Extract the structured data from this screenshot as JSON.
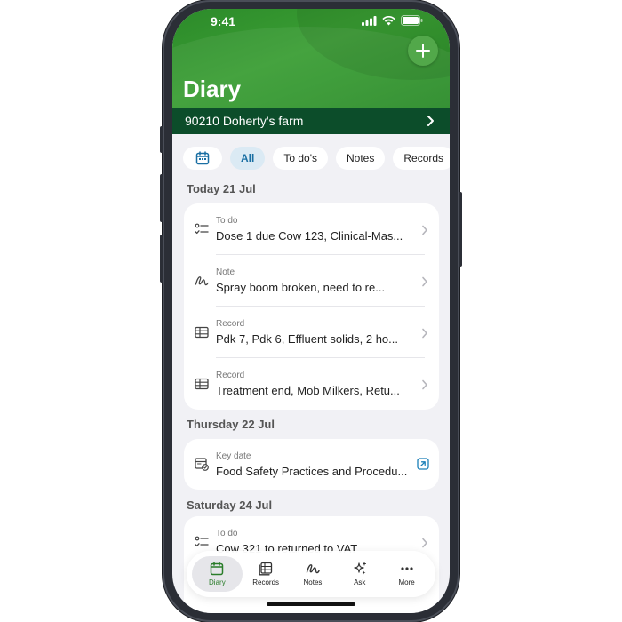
{
  "status_bar": {
    "time": "9:41"
  },
  "header": {
    "title": "Diary"
  },
  "farm": {
    "name": "90210 Doherty's farm"
  },
  "filters": [
    {
      "label": "All",
      "active": true
    },
    {
      "label": "To do's",
      "active": false
    },
    {
      "label": "Notes",
      "active": false
    },
    {
      "label": "Records",
      "active": false
    }
  ],
  "sections": [
    {
      "heading": "Today 21 Jul",
      "items": [
        {
          "type": "To do",
          "title": "Dose 1 due Cow 123, Clinical-Mas...",
          "icon": "todo-list-icon"
        },
        {
          "type": "Note",
          "title": "Spray boom broken, need to re...",
          "icon": "scribble-note-icon"
        },
        {
          "type": "Record",
          "title": "Pdk 7, Pdk 6, Effluent solids, 2 ho...",
          "icon": "table-record-icon"
        },
        {
          "type": "Record",
          "title": "Treatment end, Mob Milkers, Retu...",
          "icon": "table-record-icon"
        }
      ]
    },
    {
      "heading": "Thursday 22 Jul",
      "items": [
        {
          "type": "Key date",
          "title": "Food Safety Practices and Procedu...",
          "icon": "calendar-check-icon"
        }
      ]
    },
    {
      "heading": "Saturday 24 Jul",
      "items": [
        {
          "type": "To do",
          "title": "Cow 321 to returned to VAT",
          "icon": "todo-list-icon"
        }
      ]
    }
  ],
  "tabs": [
    {
      "label": "Diary",
      "icon": "calendar-icon",
      "active": true
    },
    {
      "label": "Records",
      "icon": "table-icon",
      "active": false
    },
    {
      "label": "Notes",
      "icon": "scribble-icon",
      "active": false
    },
    {
      "label": "Ask",
      "icon": "sparkle-icon",
      "active": false
    },
    {
      "label": "More",
      "icon": "ellipsis-icon",
      "active": false
    }
  ],
  "colors": {
    "header_green": "#3a9e33",
    "farm_bar": "#0c4d2a",
    "active_chip_bg": "#dbeaf4",
    "active_chip_text": "#1a6fa3",
    "active_tab_text": "#2a7d2a"
  }
}
